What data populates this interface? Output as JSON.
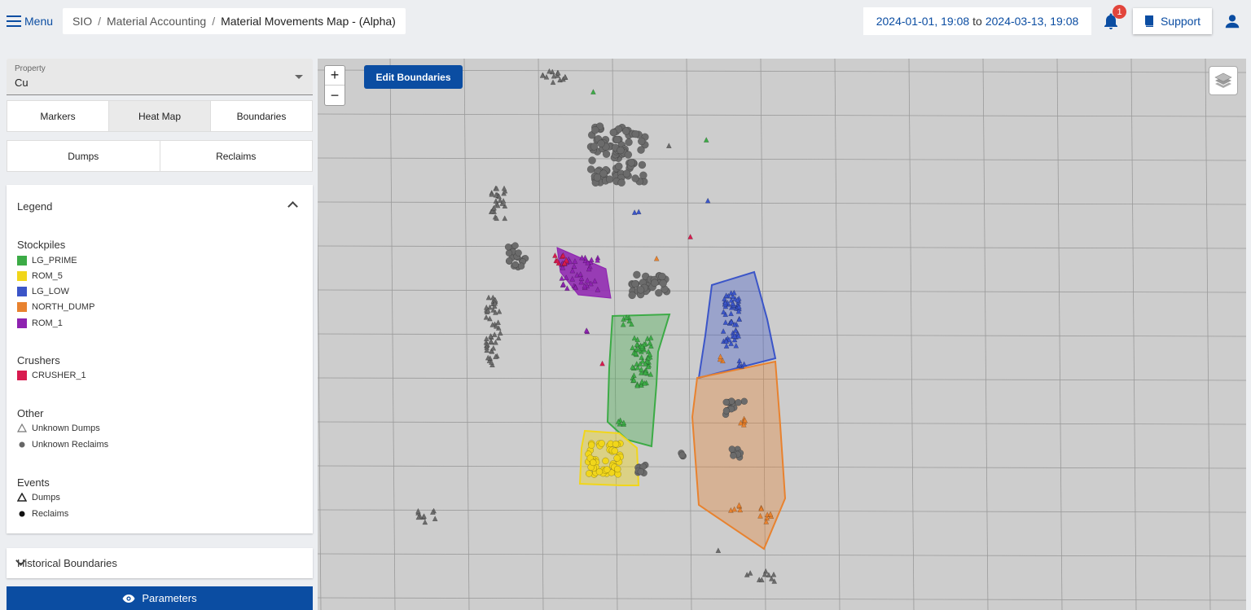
{
  "topbar": {
    "menu_label": "Menu",
    "breadcrumb": [
      "SIO",
      "Material Accounting",
      "Material Movements Map - (Alpha)"
    ],
    "date_from": "2024-01-01, 19:08",
    "date_to_word": "to",
    "date_to": "2024-03-13, 19:08",
    "notification_count": "1",
    "support_label": "Support"
  },
  "property": {
    "label": "Property",
    "value": "Cu"
  },
  "view_tabs": [
    "Markers",
    "Heat Map",
    "Boundaries"
  ],
  "active_view_tab": "Heat Map",
  "event_tabs": [
    "Dumps",
    "Reclaims"
  ],
  "legend": {
    "title": "Legend",
    "stockpiles_title": "Stockpiles",
    "stockpiles": [
      {
        "name": "LG_PRIME",
        "color": "#3cab46"
      },
      {
        "name": "ROM_5",
        "color": "#f1d61a"
      },
      {
        "name": "LG_LOW",
        "color": "#3b55c8"
      },
      {
        "name": "NORTH_DUMP",
        "color": "#e8822f"
      },
      {
        "name": "ROM_1",
        "color": "#8e22b0"
      }
    ],
    "crushers_title": "Crushers",
    "crushers": [
      {
        "name": "CRUSHER_1",
        "color": "#d81b4f"
      }
    ],
    "other_title": "Other",
    "other": [
      "Unknown Dumps",
      "Unknown Reclaims"
    ],
    "events_title": "Events",
    "events": [
      "Dumps",
      "Reclaims"
    ]
  },
  "historical_boundaries": "Historical Boundaries",
  "parameters_label": "Parameters",
  "map": {
    "edit_boundaries_label": "Edit Boundaries",
    "zoom_in": "+",
    "zoom_out": "−"
  }
}
